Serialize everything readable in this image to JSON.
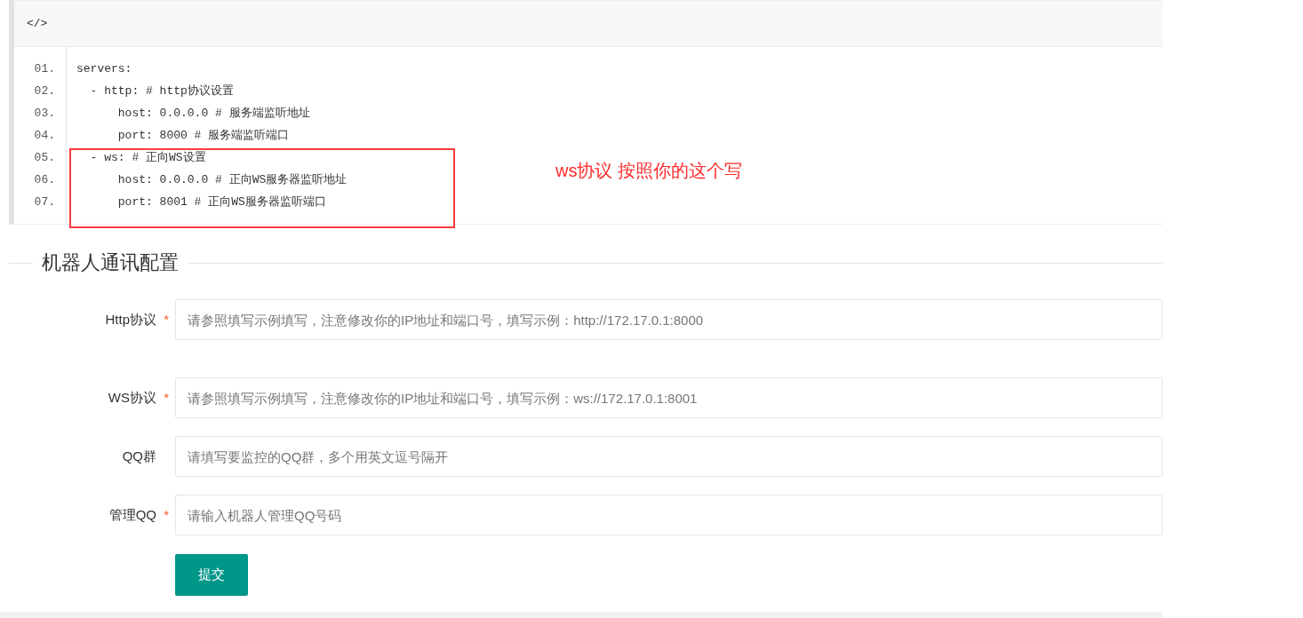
{
  "code_block": {
    "header_icon": "</>",
    "lines": [
      {
        "number": "01.",
        "text": "servers:"
      },
      {
        "number": "02.",
        "text": "  - http: # http协议设置"
      },
      {
        "number": "03.",
        "text": "      host: 0.0.0.0 # 服务端监听地址"
      },
      {
        "number": "04.",
        "text": "      port: 8000 # 服务端监听端口"
      },
      {
        "number": "05.",
        "text": "  - ws: # 正向WS设置"
      },
      {
        "number": "06.",
        "text": "      host: 0.0.0.0 # 正向WS服务器监听地址"
      },
      {
        "number": "07.",
        "text": "      port: 8001 # 正向WS服务器监听端口"
      }
    ],
    "annotation": "ws协议 按照你的这个写"
  },
  "form": {
    "legend": "机器人通讯配置",
    "fields": [
      {
        "label": "Http协议",
        "required_mark": "*",
        "placeholder": "请参照填写示例填写，注意修改你的IP地址和端口号，填写示例：http://172.17.0.1:8000"
      },
      {
        "label": "WS协议",
        "required_mark": "*",
        "placeholder": "请参照填写示例填写，注意修改你的IP地址和端口号，填写示例：ws://172.17.0.1:8001"
      },
      {
        "label": "QQ群",
        "placeholder": "请填写要监控的QQ群，多个用英文逗号隔开"
      },
      {
        "label": "管理QQ",
        "required_mark": "*",
        "placeholder": "请输入机器人管理QQ号码"
      }
    ],
    "submit": "提交"
  }
}
